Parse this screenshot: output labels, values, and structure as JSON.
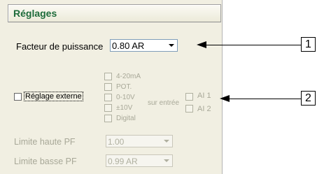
{
  "panel": {
    "title": "Réglages",
    "power_factor": {
      "label": "Facteur de puissance",
      "value": "0.80 AR"
    },
    "external": {
      "label": "Réglage externe",
      "options": [
        "4-20mA",
        "POT.",
        "0-10V",
        "±10V",
        "Digital"
      ],
      "input_label": "sur entrée",
      "inputs": [
        "AI 1",
        "AI 2"
      ]
    },
    "limit_high": {
      "label": "Limite haute PF",
      "value": "1.00"
    },
    "limit_low": {
      "label": "Limite basse PF",
      "value": "0.99 AR"
    }
  },
  "callouts": [
    "1",
    "2"
  ]
}
